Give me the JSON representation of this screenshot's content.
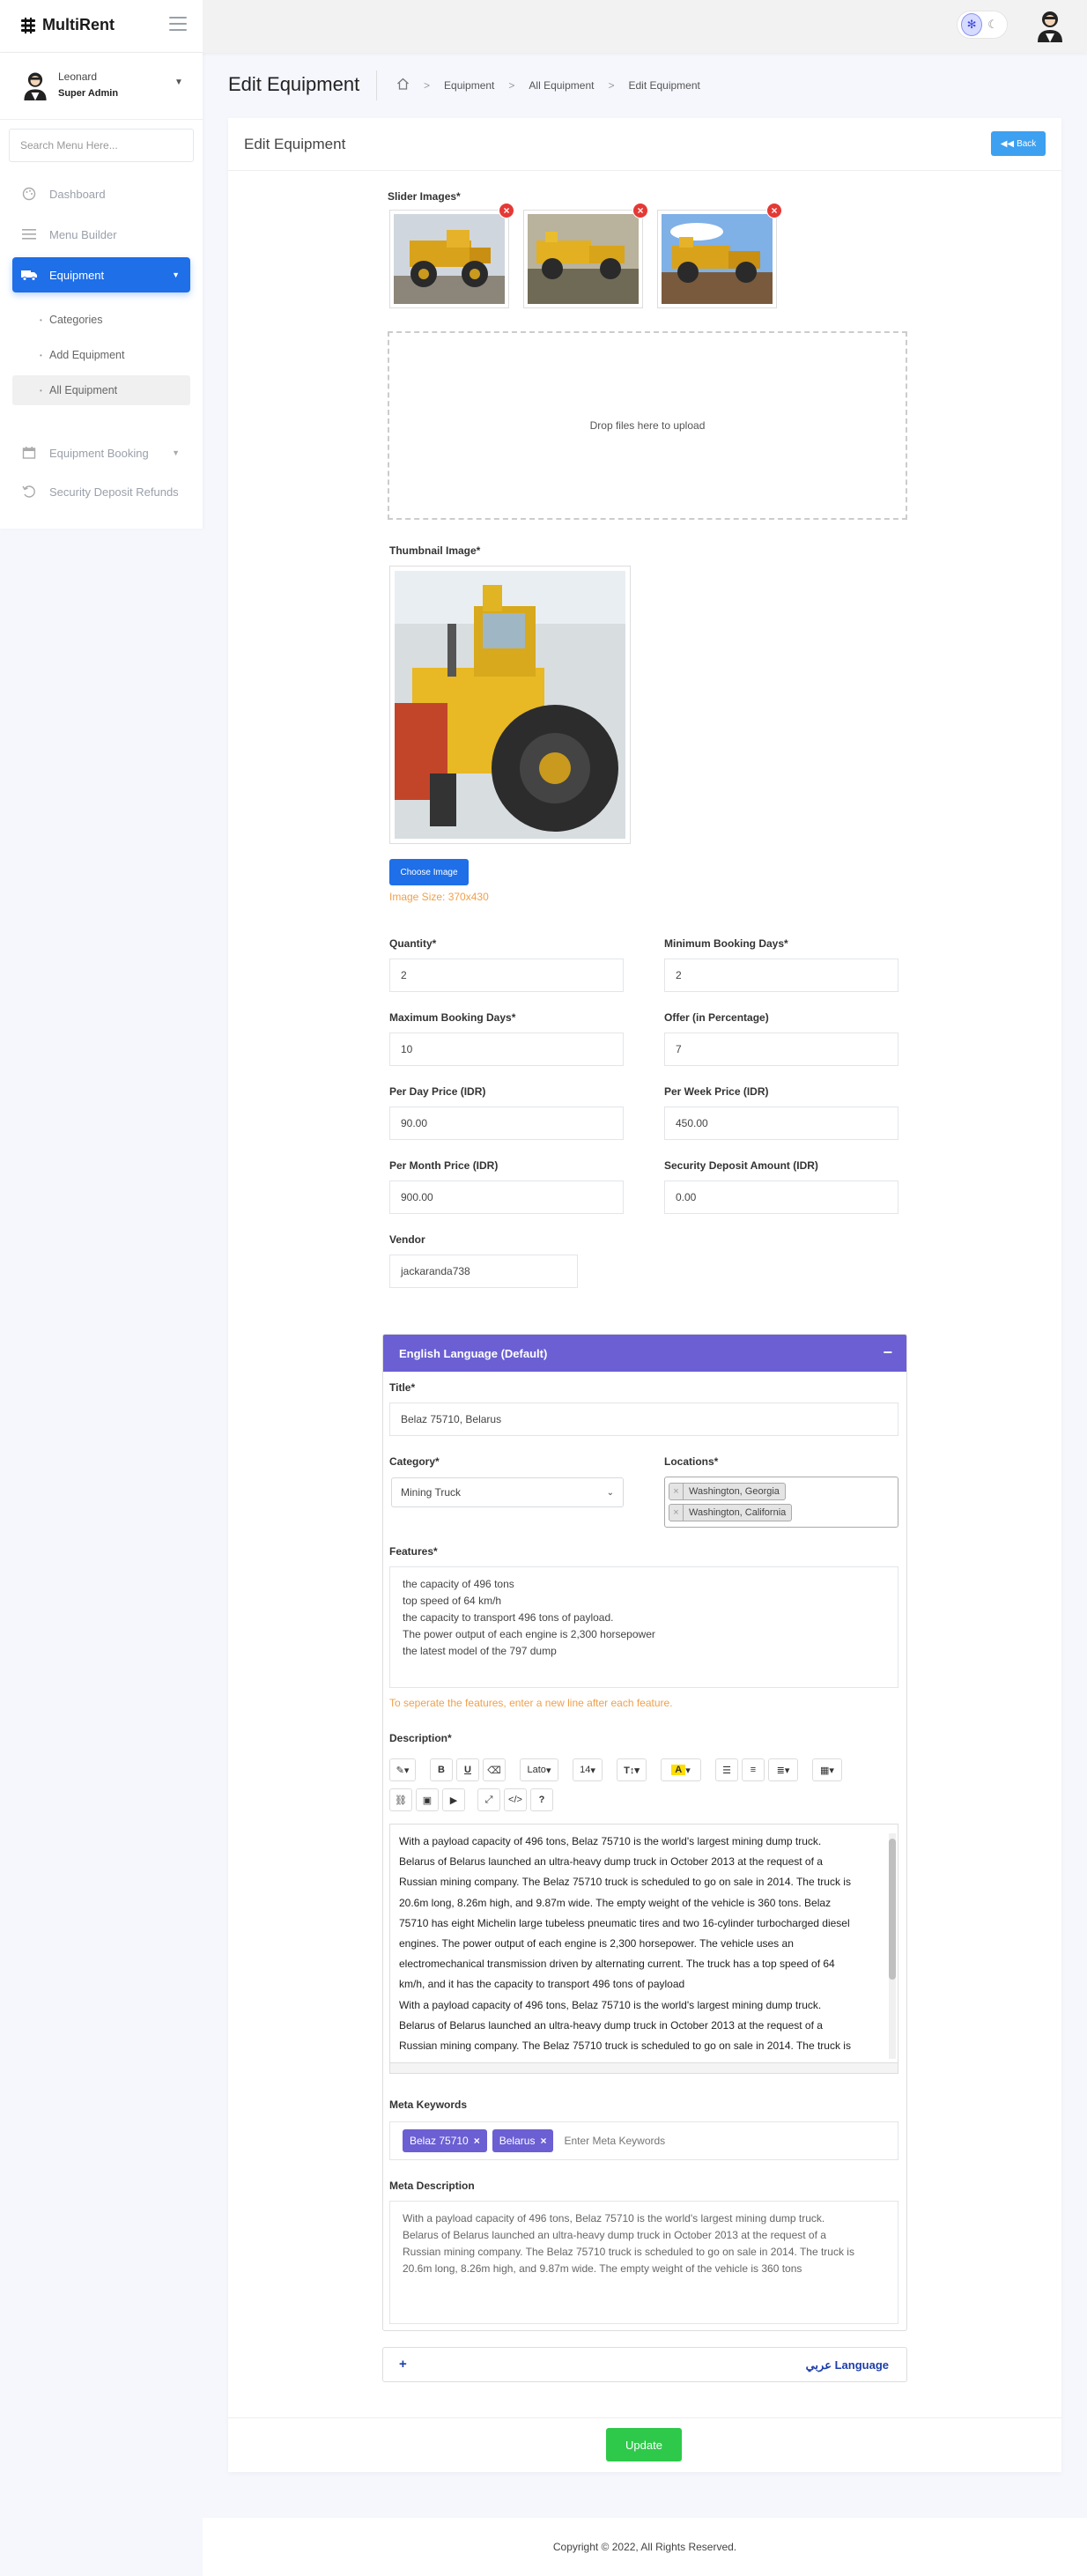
{
  "app": {
    "brand": "MultiRent"
  },
  "user": {
    "name": "Leonard",
    "role": "Super Admin"
  },
  "sidebar": {
    "search_placeholder": "Search Menu Here...",
    "items": [
      {
        "label": "Dashboard",
        "icon": "palette-icon"
      },
      {
        "label": "Menu Builder",
        "icon": "bars-icon"
      },
      {
        "label": "Equipment",
        "icon": "truck-icon"
      },
      {
        "label": "Equipment Booking",
        "icon": "calendar-icon"
      },
      {
        "label": "Security Deposit Refunds",
        "icon": "undo-icon"
      }
    ],
    "sub_items": [
      "Categories",
      "Add Equipment",
      "All Equipment"
    ]
  },
  "page": {
    "title": "Edit Equipment",
    "breadcrumb": [
      "Equipment",
      "All Equipment",
      "Edit Equipment"
    ]
  },
  "card": {
    "title": "Edit Equipment",
    "back_label": "Back",
    "slider_label": "Slider Images*",
    "dropzone_text": "Drop files here to upload",
    "thumbnail_label": "Thumbnail Image*",
    "choose_image_label": "Choose Image",
    "image_size_hint": "Image Size: 370x430"
  },
  "form": {
    "quantity": {
      "label": "Quantity*",
      "value": "2"
    },
    "min_booking_days": {
      "label": "Minimum Booking Days*",
      "value": "2"
    },
    "max_booking_days": {
      "label": "Maximum Booking Days*",
      "value": "10"
    },
    "offer": {
      "label": "Offer (in Percentage)",
      "value": "7"
    },
    "per_day_price": {
      "label": "Per Day Price (IDR)",
      "value": "90.00"
    },
    "per_week_price": {
      "label": "Per Week Price (IDR)",
      "value": "450.00"
    },
    "per_month_price": {
      "label": "Per Month Price (IDR)",
      "value": "900.00"
    },
    "security_deposit": {
      "label": "Security Deposit Amount (IDR)",
      "value": "0.00"
    },
    "vendor": {
      "label": "Vendor",
      "value": "jackaranda738"
    }
  },
  "english": {
    "header": "English Language (Default)",
    "title_label": "Title*",
    "title_value": "Belaz 75710, Belarus",
    "category_label": "Category*",
    "category_value": "Mining Truck",
    "locations_label": "Locations*",
    "locations": [
      "Washington, Georgia",
      "Washington, California"
    ],
    "features_label": "Features*",
    "features": [
      "the capacity of 496 tons",
      "top speed of 64 km/h",
      "the capacity to transport 496 tons of payload.",
      "The power output of each engine is 2,300 horsepower",
      "the latest model of the 797 dump"
    ],
    "features_hint": "To seperate the features, enter a new line after each feature.",
    "description_label": "Description*",
    "toolbar": {
      "font": "Lato",
      "size": "14"
    },
    "description_lines": [
      "With a payload capacity of 496 tons, Belaz 75710 is the world's largest mining dump truck.",
      "Belarus of Belarus launched an ultra-heavy dump truck in October 2013 at the request of a",
      "Russian mining company. The Belaz 75710 truck is scheduled to go on sale in 2014. The truck is",
      "20.6m long, 8.26m high, and 9.87m wide. The empty weight of the vehicle is 360 tons. Belaz",
      "75710 has eight Michelin large tubeless pneumatic tires and two 16-cylinder turbocharged diesel",
      "engines. The power output of each engine is 2,300 horsepower. The vehicle uses an",
      "electromechanical transmission driven by alternating current. The truck has a top speed of 64",
      "km/h, and it has the capacity to transport 496 tons of payload",
      "With a payload capacity of 496 tons, Belaz 75710 is the world's largest mining dump truck.",
      "Belarus of Belarus launched an ultra-heavy dump truck in October 2013 at the request of a",
      "Russian mining company. The Belaz 75710 truck is scheduled to go on sale in 2014. The truck is"
    ],
    "meta_keywords_label": "Meta Keywords",
    "meta_keywords": [
      "Belaz 75710",
      "Belarus"
    ],
    "meta_keywords_placeholder": "Enter Meta Keywords",
    "meta_description_label": "Meta Description",
    "meta_description_lines": [
      "With a payload capacity of 496 tons, Belaz 75710 is the world's largest mining dump truck.",
      "Belarus of Belarus launched an ultra-heavy dump truck in October 2013 at the request of a",
      "Russian mining company. The Belaz 75710 truck is scheduled to go on sale in 2014. The truck is",
      "20.6m long, 8.26m high, and 9.87m wide. The empty weight of the vehicle is 360 tons"
    ]
  },
  "arabic": {
    "label": "عربي Language"
  },
  "actions": {
    "update_label": "Update"
  },
  "footer": {
    "copyright": "Copyright © 2022, All Rights Reserved."
  },
  "colors": {
    "primary": "#1e6fe8",
    "accent": "#6b5fd3",
    "success": "#2ec94a",
    "danger": "#e53935",
    "hint": "#f0a04a"
  }
}
